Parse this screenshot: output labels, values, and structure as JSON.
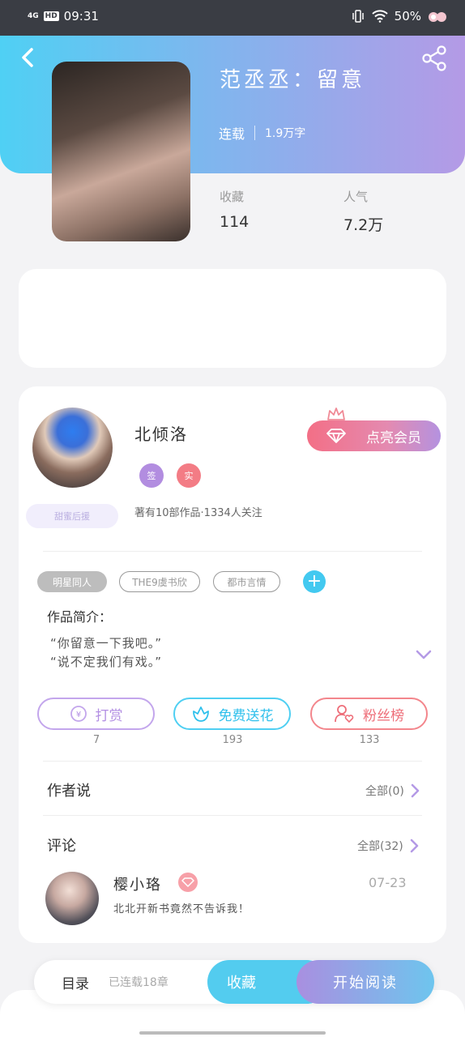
{
  "status_bar": {
    "time": "09:31",
    "network": "4G",
    "hd": "HD",
    "battery": "50%"
  },
  "book": {
    "title": "范丞丞：留意",
    "status": "连载",
    "word_count": "1.9万字"
  },
  "stats": [
    {
      "label": "收藏",
      "value": "114"
    },
    {
      "label": "人气",
      "value": "7.2万"
    }
  ],
  "author": {
    "name": "北倾洛",
    "tags": [
      "签",
      "实"
    ],
    "fan_badge": "甜蜜后援",
    "meta": "著有10部作品·1334人关注",
    "vip_button": "点亮会员"
  },
  "genre_tags": [
    "明星同人",
    "THE9虞书欣",
    "都市言情"
  ],
  "intro": {
    "title": "作品简介：",
    "lines": [
      "“你留意一下我吧。”",
      "“说不定我们有戏。”"
    ]
  },
  "actions": [
    {
      "label": "打赏",
      "count": "7"
    },
    {
      "label": "免费送花",
      "count": "193"
    },
    {
      "label": "粉丝榜",
      "count": "133"
    }
  ],
  "author_says": {
    "title": "作者说",
    "all_label": "全部(0)"
  },
  "comments": {
    "title": "评论",
    "all_label": "全部(32)",
    "first": {
      "user": "樱小珞",
      "date": "07-23",
      "text": "北北开新书竟然不告诉我！"
    }
  },
  "bottom_bar": {
    "catalog": "目录",
    "progress": "已连载18章",
    "collect": "收藏",
    "read": "开始阅读"
  },
  "colors": {
    "accent_blue": "#53ccef",
    "accent_purple": "#b49ae6",
    "vip_pink": "#f36f86"
  }
}
